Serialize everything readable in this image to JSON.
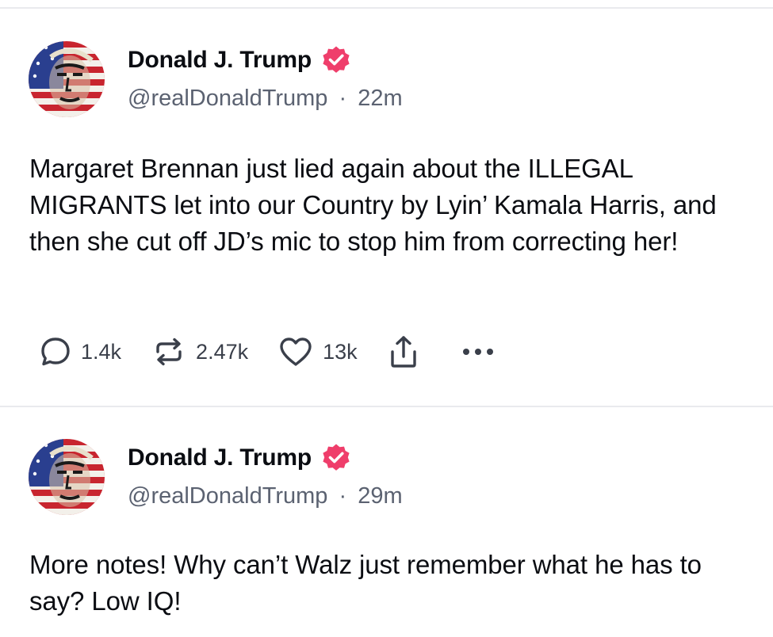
{
  "accent_color": "#ef3e6b",
  "posts": [
    {
      "author": {
        "name": "Donald J. Trump",
        "handle": "@realDonaldTrump",
        "verified_icon": "verified-badge-icon"
      },
      "separator": "·",
      "time": "22m",
      "body": "Margaret Brennan just lied again about the ILLEGAL MIGRANTS let into our Country by Lyin’ Kamala Harris, and then she cut off JD’s mic to stop him from correcting her!",
      "actions": {
        "replies": "1.4k",
        "reposts": "2.47k",
        "likes": "13k",
        "reply_icon": "reply-icon",
        "repost_icon": "repost-icon",
        "like_icon": "heart-icon",
        "share_icon": "share-icon",
        "more_icon": "more-icon"
      }
    },
    {
      "author": {
        "name": "Donald J. Trump",
        "handle": "@realDonaldTrump",
        "verified_icon": "verified-badge-icon"
      },
      "separator": "·",
      "time": "29m",
      "body": "More notes! Why can’t Walz just remember what he has to say? Low IQ!"
    }
  ]
}
